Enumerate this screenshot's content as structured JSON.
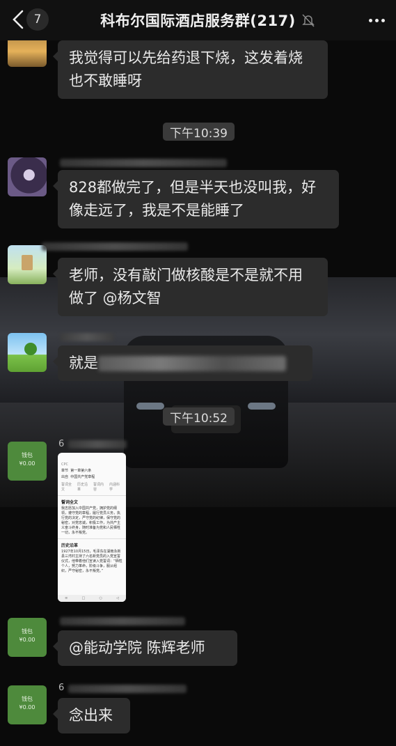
{
  "header": {
    "unread_count": "7",
    "title": "科布尔国际酒店服务群(217)"
  },
  "messages": [
    {
      "text": "我觉得可以先给药退下烧，这发着烧也不敢睡呀"
    },
    {
      "time": "下午10:39"
    },
    {
      "text": "828都做完了，但是半天也没叫我，好像走远了，我是不是能睡了"
    },
    {
      "text": "老师，没有敲门做核酸是不是就不用做了 @杨文智"
    },
    {
      "text_visible": "就是"
    },
    {
      "time": "下午10:52"
    },
    {
      "sender_partial": "6",
      "image": {
        "brand_small": "CPC",
        "field1_label": "章节",
        "field1_value": "第一章第六条",
        "field2_label": "出自",
        "field2_value": "中国共产党章程",
        "tabs": [
          "誓词全文",
          "历史沿革",
          "誓词内容",
          "内涵科学"
        ],
        "section1_title": "誓词全文",
        "section1_text": "我志愿加入中国共产党，拥护党的纲领，遵守党的章程，履行党员义务，执行党的决定，严守党的纪律，保守党的秘密，对党忠诚，积极工作，为共产主义奋斗终身，随时准备为党和人民牺牲一切，永不叛党。",
        "section2_title": "历史沿革",
        "section2_text": "1927年10月15日，毛泽东在湖南永新县三湾村主持了六名新党员的入党宣誓仪式，他带着他们宣读入党誓词：“牺牲个人，努力革命，阶级斗争，服从组织，严守秘密，永不叛党。”"
      }
    },
    {
      "text": "@能动学院 陈辉老师"
    },
    {
      "sender_partial": "6",
      "text": "念出来"
    }
  ],
  "wallet_avatar": {
    "line1": "钱包",
    "line2": "¥0.00"
  }
}
